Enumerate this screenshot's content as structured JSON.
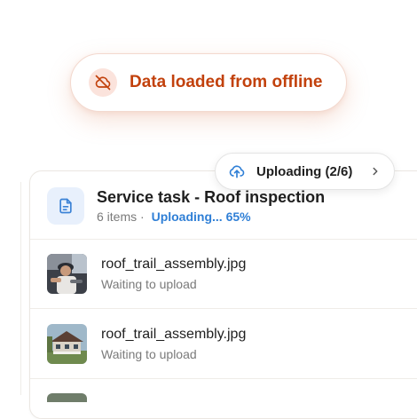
{
  "offline_toast": {
    "message": "Data loaded from offline",
    "icon": "cloud-off-icon",
    "accent_color": "#c2410c"
  },
  "upload_status": {
    "label": "Uploading (2/6)",
    "icon": "cloud-upload-icon",
    "chevron": "chevron-right-icon"
  },
  "task": {
    "title": "Service task - Roof inspection",
    "items_count": "6 items ·",
    "progress_text": "Uploading... 65%",
    "progress_fraction": 0.65,
    "icon": "document-icon",
    "accent_color": "#2f7fd6"
  },
  "files": [
    {
      "name": "roof_trail_assembly.jpg",
      "status": "Waiting to upload",
      "thumbnail": "worker-photo"
    },
    {
      "name": "roof_trail_assembly.jpg",
      "status": "Waiting to upload",
      "thumbnail": "house-photo"
    }
  ]
}
